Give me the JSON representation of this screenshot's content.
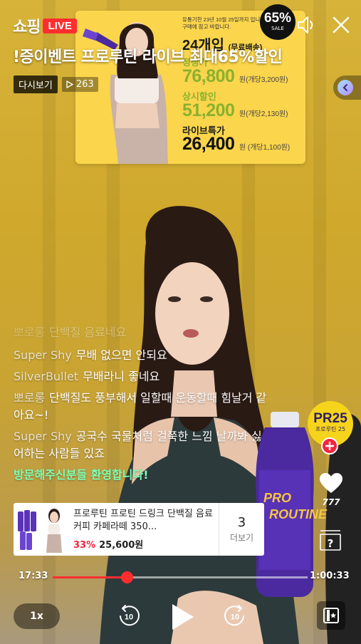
{
  "header": {
    "brand": "쇼핑",
    "live_badge": "LIVE",
    "marquee": "!증이벤트      프로루틴 라이브 최대65%할인"
  },
  "stream": {
    "replay_label": "다시보기",
    "view_count": "263"
  },
  "promo": {
    "note_line1": "유통기한 23년 10월 25일까지 입니다.",
    "note_line2": "구매에 참고 바랍니다.",
    "count": "24개입",
    "count_note": "(무료배송)",
    "regular_label": "정상가",
    "regular_price": "76,800",
    "regular_unit": "원(개당3,200원)",
    "sale_label": "상시할인",
    "sale_price": "51,200",
    "sale_unit": "원(개당2,130원)",
    "live_label": "라이브특가",
    "live_price": "26,400",
    "live_unit": "원 (개당1,100원)"
  },
  "sale_badge": {
    "value": "65%",
    "label": "SALE"
  },
  "chat": {
    "messages": [
      {
        "user": "뽀로롱",
        "text": "단백질 음료네요"
      },
      {
        "user": "Super Shy",
        "text": "무배 없으면 안되요"
      },
      {
        "user": "SilverBullet",
        "text": "무배라니 좋네요"
      },
      {
        "user": "뽀로롱",
        "text": "단백질도 풍부해서 일할때 운동할때 힘날거 같아요~!"
      },
      {
        "user": "Super Shy",
        "text": "공국수 국물처럼 걸쭉한 느낌 날까봐 싫어하는 사람들 있죠"
      }
    ],
    "welcome": "방문해주신분들 환영합니다!"
  },
  "product": {
    "name": "프로루틴 프로틴 드링크 단백질 음료 커피 카페라떼 350...",
    "discount": "33%",
    "price": "25,600원",
    "more_count": "3",
    "more_label": "더보기"
  },
  "actions": {
    "pr_badge_big": "PR25",
    "pr_badge_small": "프로루틴 25",
    "like_count": "777"
  },
  "player": {
    "current_time": "17:33",
    "total_time": "1:00:33",
    "progress": 0.29,
    "speed": "1x",
    "skip_seconds": "10"
  },
  "colors": {
    "live_red": "#ff2e2e",
    "discount_red": "#f0263e",
    "welcome_green": "#7fffb4",
    "promo_yellow": "#fbd54c",
    "price_green": "#8bb12d"
  },
  "icons": [
    "mute-icon",
    "close-icon",
    "play-icon",
    "rewind-10-icon",
    "forward-10-icon",
    "heart-icon",
    "help-icon",
    "layout-icon",
    "plus-icon"
  ]
}
